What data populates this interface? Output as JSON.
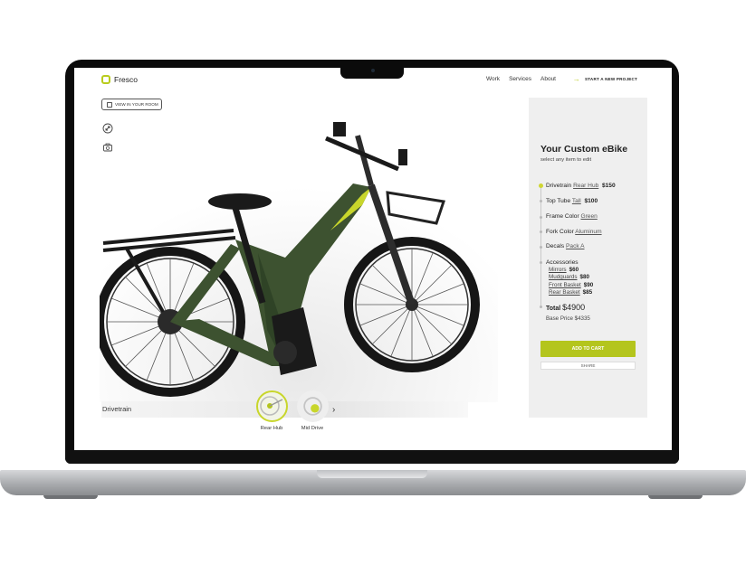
{
  "brand": {
    "name": "Fresco",
    "accent": "#b9cc1d"
  },
  "nav": {
    "items": [
      "Work",
      "Services",
      "About"
    ],
    "cta": "START A NEW PROJECT"
  },
  "toolbar": {
    "view_in_room": "VIEW IN YOUR ROOM"
  },
  "viewer": {
    "category_label": "Drivetrain",
    "options": [
      {
        "label": "Rear Hub",
        "selected": true
      },
      {
        "label": "Mid Drive",
        "selected": false
      }
    ]
  },
  "config": {
    "title": "Your Custom eBike",
    "subtitle": "select any item to edit",
    "items": [
      {
        "label": "Drivetrain",
        "value": "Rear Hub",
        "price": "$150"
      },
      {
        "label": "Top Tube",
        "value": "Tall",
        "price": "$100"
      },
      {
        "label": "Frame Color",
        "value": "Green",
        "price": ""
      },
      {
        "label": "Fork Color",
        "value": "Aluminum",
        "price": ""
      },
      {
        "label": "Decals",
        "value": "Pack A",
        "price": ""
      }
    ],
    "accessories_label": "Accessories",
    "accessories": [
      {
        "name": "Mirrors",
        "price": "$60"
      },
      {
        "name": "Mudguards",
        "price": "$80"
      },
      {
        "name": "Front Basket",
        "price": "$90"
      },
      {
        "name": "Rear Basket",
        "price": "$85"
      }
    ],
    "total_label": "Total",
    "total_value": "$4900",
    "base_price": "Base Price $4335",
    "add_to_cart": "ADD TO CART",
    "share": "SHARE"
  }
}
